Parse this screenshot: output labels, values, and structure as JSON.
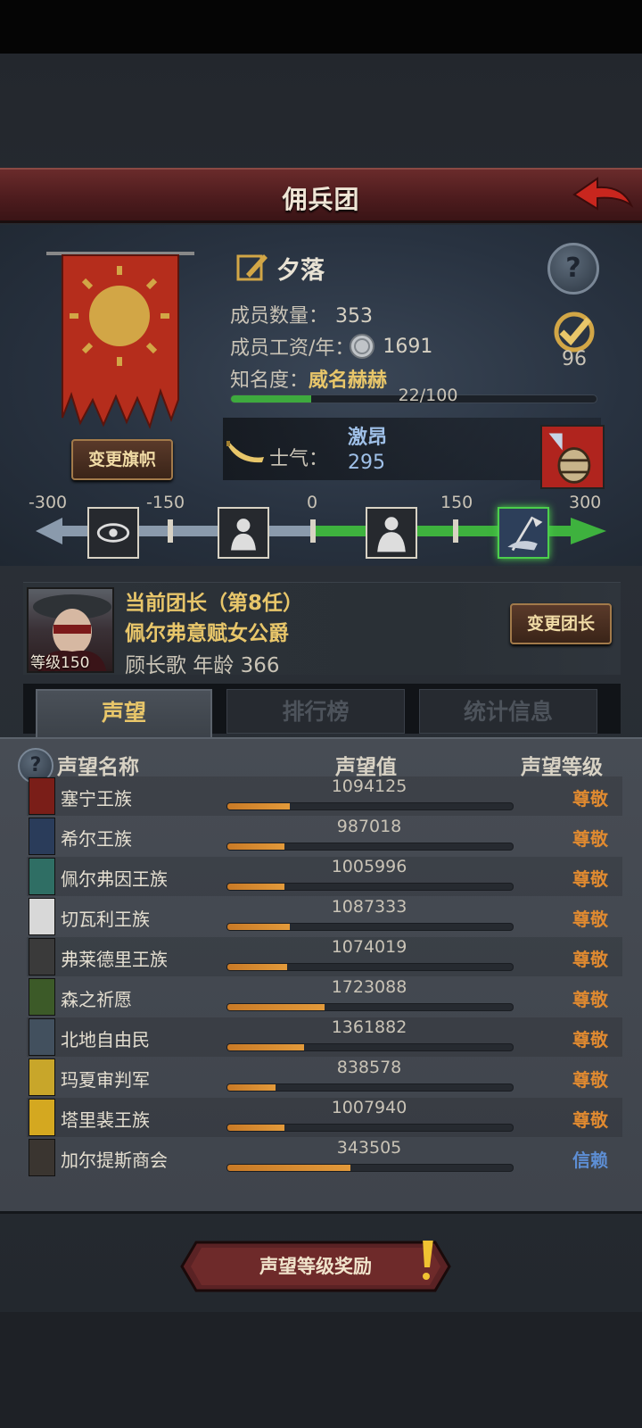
{
  "header": {
    "title": "佣兵团"
  },
  "company": {
    "name": "夕落",
    "members_label": "成员数量：",
    "members": "353",
    "wage_label": "成员工资/年：",
    "wage": "1691",
    "fame_label": "知名度：",
    "fame_value": "威名赫赫",
    "fame_progress": "22/100",
    "fame_fraction": 0.22,
    "badge_number": "96",
    "change_flag_label": "变更旗帜"
  },
  "morale": {
    "label": "士气：",
    "state": "激昂",
    "value": "295",
    "scale_labels": [
      "-300",
      "-150",
      "0",
      "150",
      "300"
    ]
  },
  "leader": {
    "title": "当前团长（第8任）",
    "name": "佩尔弗意赋女公爵",
    "level_label": "等级150",
    "line3": "顾长歌 年龄 366",
    "change_label": "变更团长"
  },
  "tabs": [
    "声望",
    "排行榜",
    "统计信息"
  ],
  "reputation": {
    "headers": {
      "name": "声望名称",
      "value": "声望值",
      "level": "声望等级"
    },
    "rows": [
      {
        "name": "塞宁王族",
        "value": "1094125",
        "level": "尊敬",
        "fill": 0.22,
        "color": "#7a1e18"
      },
      {
        "name": "希尔王族",
        "value": "987018",
        "level": "尊敬",
        "fill": 0.2,
        "color": "#2a3c5a"
      },
      {
        "name": "佩尔弗因王族",
        "value": "1005996",
        "level": "尊敬",
        "fill": 0.2,
        "color": "#2f6e64"
      },
      {
        "name": "切瓦利王族",
        "value": "1087333",
        "level": "尊敬",
        "fill": 0.22,
        "color": "#d8d8d8"
      },
      {
        "name": "弗莱德里王族",
        "value": "1074019",
        "level": "尊敬",
        "fill": 0.21,
        "color": "#3a3a3a"
      },
      {
        "name": "森之祈愿",
        "value": "1723088",
        "level": "尊敬",
        "fill": 0.34,
        "color": "#3c5a28"
      },
      {
        "name": "北地自由民",
        "value": "1361882",
        "level": "尊敬",
        "fill": 0.27,
        "color": "#42505e"
      },
      {
        "name": "玛夏审判军",
        "value": "838578",
        "level": "尊敬",
        "fill": 0.17,
        "color": "#c8a62a"
      },
      {
        "name": "塔里裴王族",
        "value": "1007940",
        "level": "尊敬",
        "fill": 0.2,
        "color": "#d4a820"
      },
      {
        "name": "加尔提斯商会",
        "value": "343505",
        "level": "信赖",
        "fill": 0.43,
        "color": "#3a3530"
      }
    ],
    "level_colors": {
      "尊敬": "#e08a30",
      "信赖": "#5d8ed4"
    }
  },
  "reward_button": {
    "label": "声望等级奖励"
  }
}
